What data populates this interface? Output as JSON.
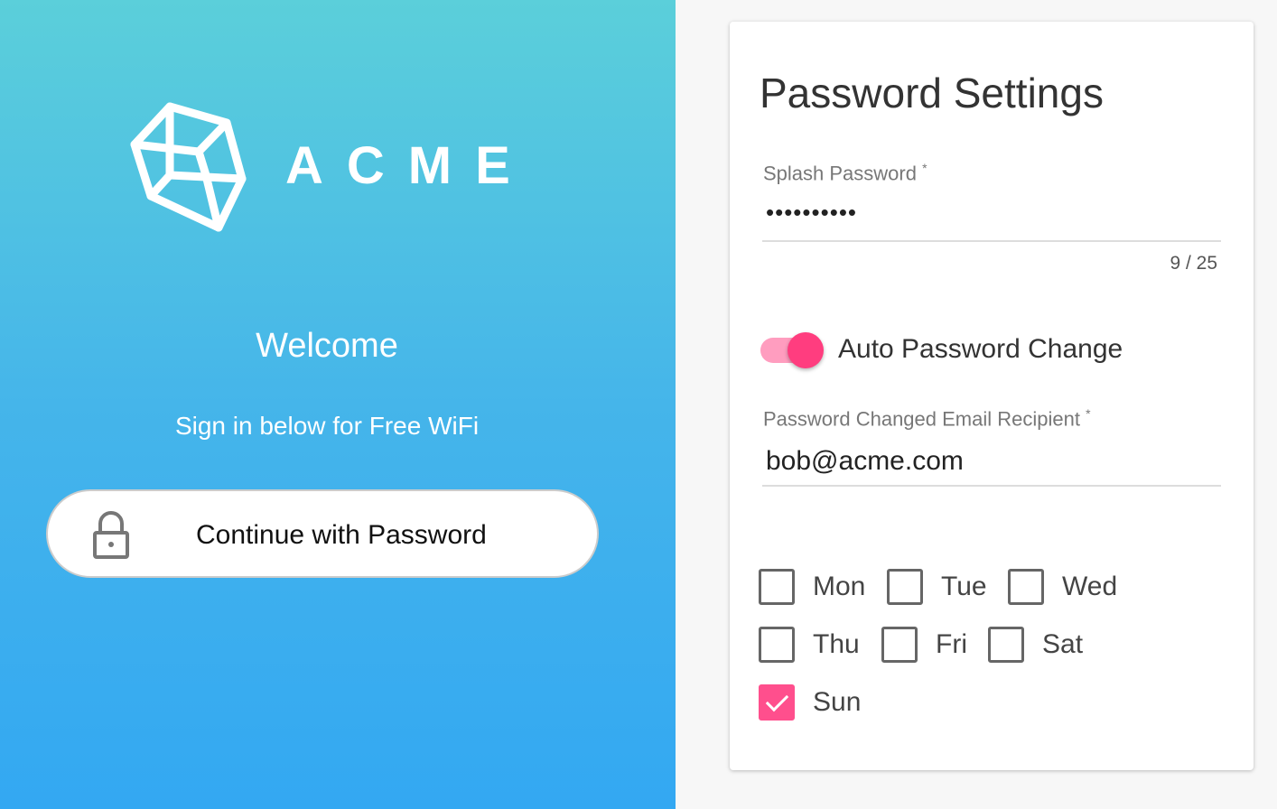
{
  "brand": {
    "name": "ACME",
    "welcome": "Welcome",
    "subtitle": "Sign in below for Free WiFi",
    "button_label": "Continue with Password"
  },
  "settings": {
    "title": "Password Settings",
    "password": {
      "label": "Splash Password",
      "required": "*",
      "value": "••••••••••",
      "counter": "9 / 25"
    },
    "auto_change": {
      "label": "Auto Password Change",
      "on": true
    },
    "email": {
      "label": "Password Changed Email Recipient",
      "required": "*",
      "value": "bob@acme.com"
    },
    "days": [
      {
        "label": "Mon",
        "checked": false
      },
      {
        "label": "Tue",
        "checked": false
      },
      {
        "label": "Wed",
        "checked": false
      },
      {
        "label": "Thu",
        "checked": false
      },
      {
        "label": "Fri",
        "checked": false
      },
      {
        "label": "Sat",
        "checked": false
      },
      {
        "label": "Sun",
        "checked": true
      }
    ]
  },
  "colors": {
    "accent": "#ff3d7f",
    "gradient_top": "#5bcfda",
    "gradient_bottom": "#33a8f2"
  }
}
